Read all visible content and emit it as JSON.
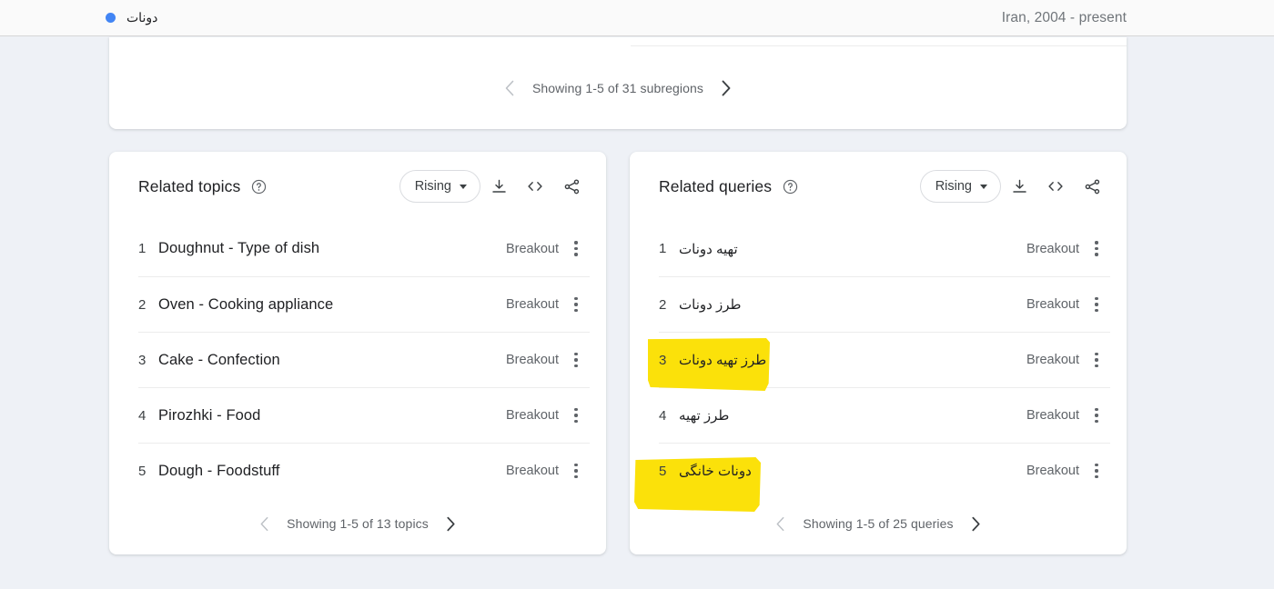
{
  "topbar": {
    "series_label": "دونات",
    "series_dot_color": "#4285f4",
    "region_period": "Iran, 2004 - present"
  },
  "subregions_card": {
    "pager": {
      "prev_icon": "chevron-left-icon",
      "text": "Showing 1-5 of 31 subregions",
      "next_icon": "chevron-right-icon"
    }
  },
  "related_topics": {
    "title": "Related topics",
    "help_icon": "help-circle-icon",
    "sort": {
      "value": "Rising",
      "caret_icon": "chevron-down-icon"
    },
    "actions": [
      {
        "name": "download-icon",
        "label": "Download"
      },
      {
        "name": "embed-code-icon",
        "label": "Embed"
      },
      {
        "name": "share-icon",
        "label": "Share"
      }
    ],
    "rows": [
      {
        "rank": "1",
        "label": "Doughnut - Type of dish",
        "value": "Breakout",
        "menu_icon": "more-vert-icon"
      },
      {
        "rank": "2",
        "label": "Oven - Cooking appliance",
        "value": "Breakout",
        "menu_icon": "more-vert-icon"
      },
      {
        "rank": "3",
        "label": "Cake - Confection",
        "value": "Breakout",
        "menu_icon": "more-vert-icon"
      },
      {
        "rank": "4",
        "label": "Pirozhki - Food",
        "value": "Breakout",
        "menu_icon": "more-vert-icon"
      },
      {
        "rank": "5",
        "label": "Dough - Foodstuff",
        "value": "Breakout",
        "menu_icon": "more-vert-icon"
      }
    ],
    "pager": {
      "prev_icon": "chevron-left-icon",
      "text": "Showing 1-5 of 13 topics",
      "next_icon": "chevron-right-icon"
    }
  },
  "related_queries": {
    "title": "Related queries",
    "help_icon": "help-circle-icon",
    "sort": {
      "value": "Rising",
      "caret_icon": "chevron-down-icon"
    },
    "actions": [
      {
        "name": "download-icon",
        "label": "Download"
      },
      {
        "name": "embed-code-icon",
        "label": "Embed"
      },
      {
        "name": "share-icon",
        "label": "Share"
      }
    ],
    "rows": [
      {
        "rank": "1",
        "label": "تهیه دونات",
        "value": "Breakout",
        "menu_icon": "more-vert-icon",
        "highlighted": false
      },
      {
        "rank": "2",
        "label": "طرز دونات",
        "value": "Breakout",
        "menu_icon": "more-vert-icon",
        "highlighted": false
      },
      {
        "rank": "3",
        "label": "طرز تهیه دونات",
        "value": "Breakout",
        "menu_icon": "more-vert-icon",
        "highlighted": true
      },
      {
        "rank": "4",
        "label": "طرز تهیه",
        "value": "Breakout",
        "menu_icon": "more-vert-icon",
        "highlighted": false
      },
      {
        "rank": "5",
        "label": "دونات خانگی",
        "value": "Breakout",
        "menu_icon": "more-vert-icon",
        "highlighted": true
      }
    ],
    "pager": {
      "prev_icon": "chevron-left-icon",
      "text": "Showing 1-5 of 25 queries",
      "next_icon": "chevron-right-icon"
    }
  },
  "annotations": {
    "highlight_color": "#fbe10a",
    "marks": [
      {
        "target_row": 3,
        "panel": "related_queries"
      },
      {
        "target_row": 5,
        "panel": "related_queries"
      }
    ]
  }
}
